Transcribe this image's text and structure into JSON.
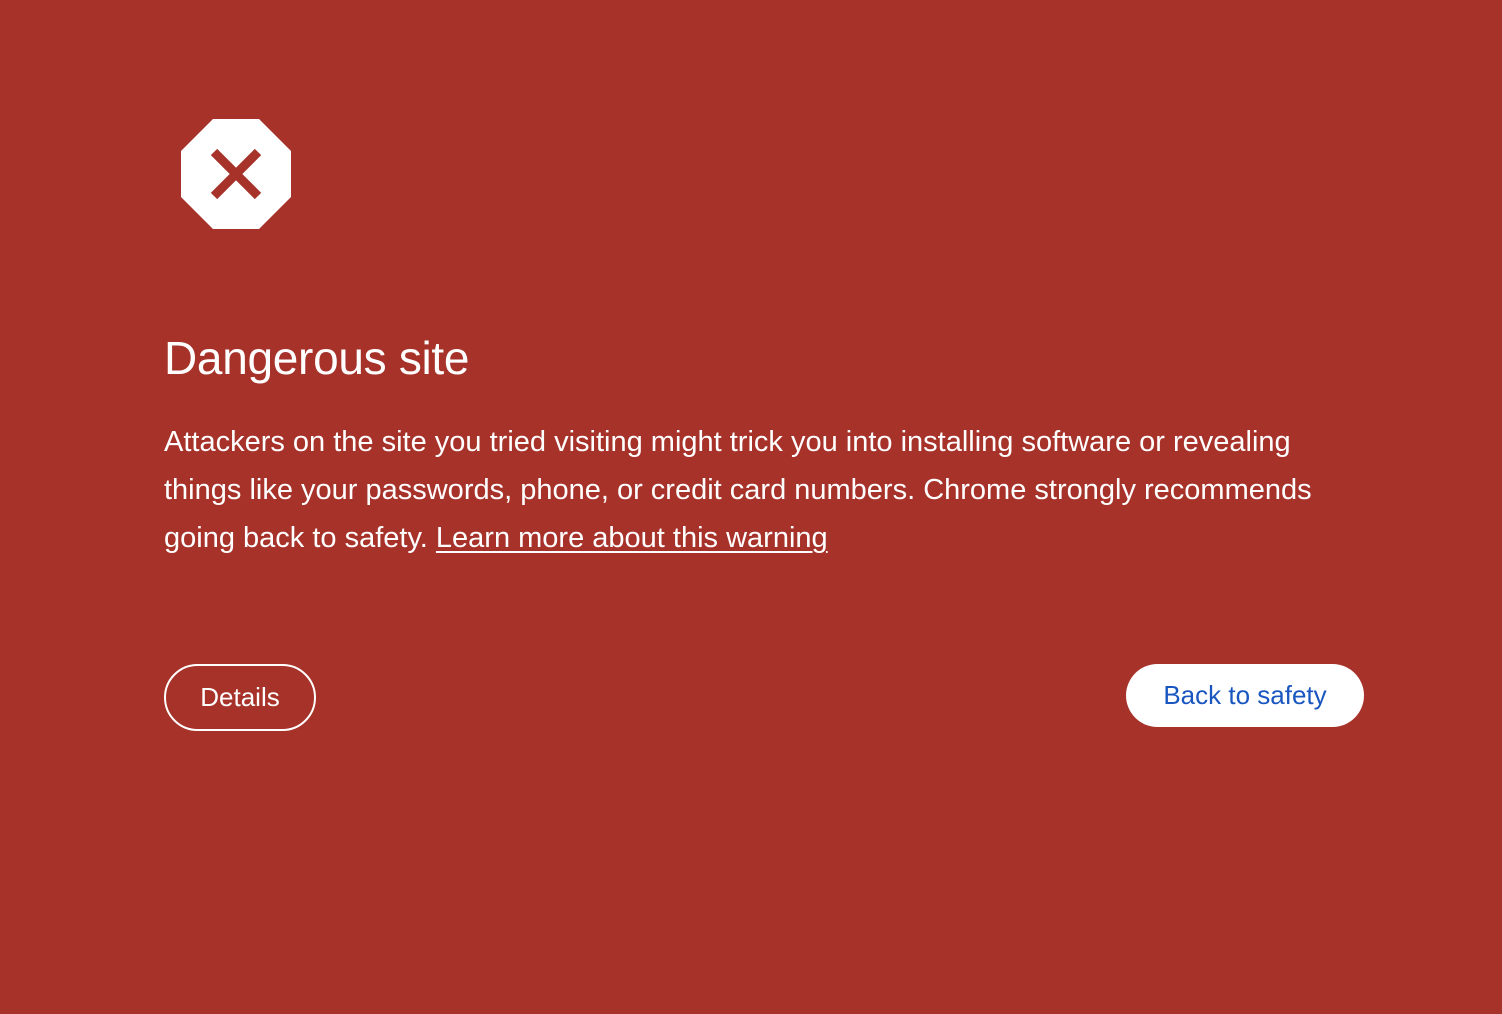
{
  "icon": {
    "name": "stop-sign-x-icon",
    "fill": "#ffffff",
    "mark_color": "#a6322a"
  },
  "heading": "Dangerous site",
  "body": {
    "text": "Attackers on the site you tried visiting might trick you into installing software or revealing things like your passwords, phone, or credit card numbers. Chrome strongly recommends going back to safety.",
    "link_label": "Learn more about this warning"
  },
  "buttons": {
    "details_label": "Details",
    "back_to_safety_label": "Back to safety"
  },
  "colors": {
    "background": "#a6322a",
    "primary_button_text": "#1a56c0"
  }
}
